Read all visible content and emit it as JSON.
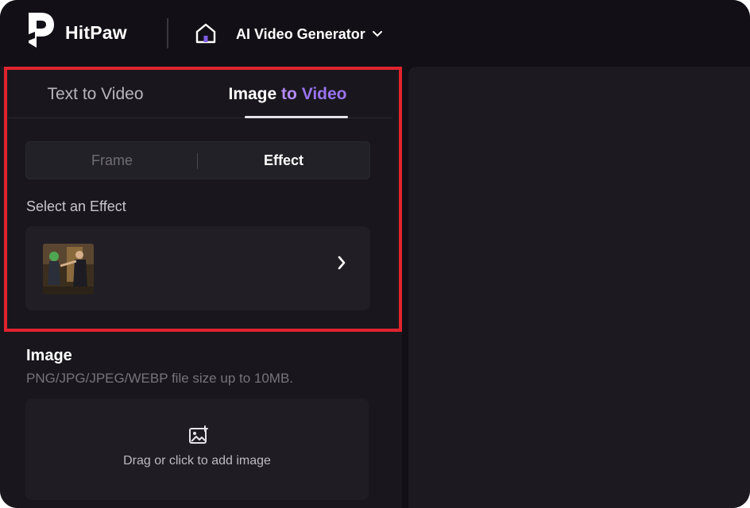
{
  "app": {
    "brand": "HitPaw",
    "product": "AI Video Generator"
  },
  "tabs": [
    {
      "label": "Text to Video",
      "active": false
    },
    {
      "label_parts": [
        "Image",
        "to",
        "Video"
      ],
      "active": true
    }
  ],
  "mode_switch": {
    "options": [
      "Frame",
      "Effect"
    ],
    "selected": "Effect"
  },
  "effect": {
    "section_label": "Select an Effect"
  },
  "image": {
    "title": "Image",
    "hint": "PNG/JPG/JPEG/WEBP file size up to 10MB.",
    "dropzone_text": "Drag or click to add image"
  },
  "colors": {
    "background": "#121016",
    "panel": "#19171d",
    "accent_purple": "#b48bf5",
    "highlight_red": "#e0242f"
  },
  "icons": [
    "hitpaw-logo-icon",
    "home-icon",
    "chevron-down-icon",
    "chevron-right-icon",
    "add-image-icon"
  ]
}
